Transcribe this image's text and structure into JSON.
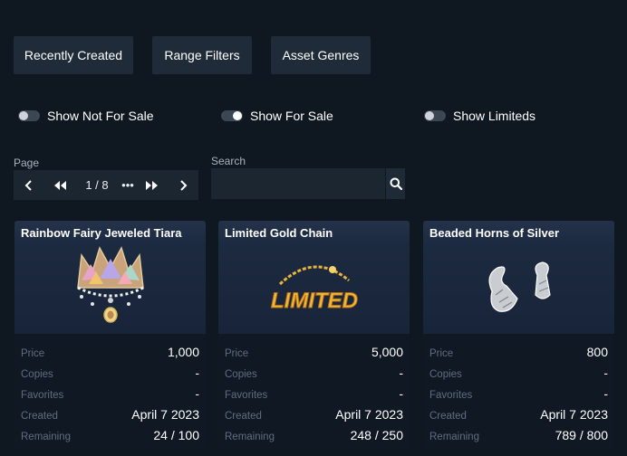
{
  "filters": {
    "buttons": [
      "Recently Created",
      "Range Filters",
      "Asset Genres"
    ],
    "toggles": [
      {
        "label": "Show Not For Sale",
        "on": false
      },
      {
        "label": "Show For Sale",
        "on": true
      },
      {
        "label": "Show Limiteds",
        "on": false
      }
    ]
  },
  "pagination": {
    "label": "Page",
    "current": "1 / 8",
    "more": "•••"
  },
  "search": {
    "label": "Search",
    "placeholder": ""
  },
  "row_labels": {
    "price": "Price",
    "copies": "Copies",
    "favorites": "Favorites",
    "created": "Created",
    "remaining": "Remaining"
  },
  "items": [
    {
      "name": "Rainbow Fairy Jeweled Tiara",
      "image_icon": "tiara-icon",
      "price": "1,000",
      "copies": "-",
      "favorites": "-",
      "created": "April 7 2023",
      "remaining": "24 / 100"
    },
    {
      "name": "Limited Gold Chain",
      "image_icon": "gold-chain-icon",
      "image_text": "LIMITED",
      "price": "5,000",
      "copies": "-",
      "favorites": "-",
      "created": "April 7 2023",
      "remaining": "248 / 250"
    },
    {
      "name": "Beaded Horns of Silver",
      "image_icon": "silver-horns-icon",
      "price": "800",
      "copies": "-",
      "favorites": "-",
      "created": "April 7 2023",
      "remaining": "789 / 800"
    }
  ]
}
